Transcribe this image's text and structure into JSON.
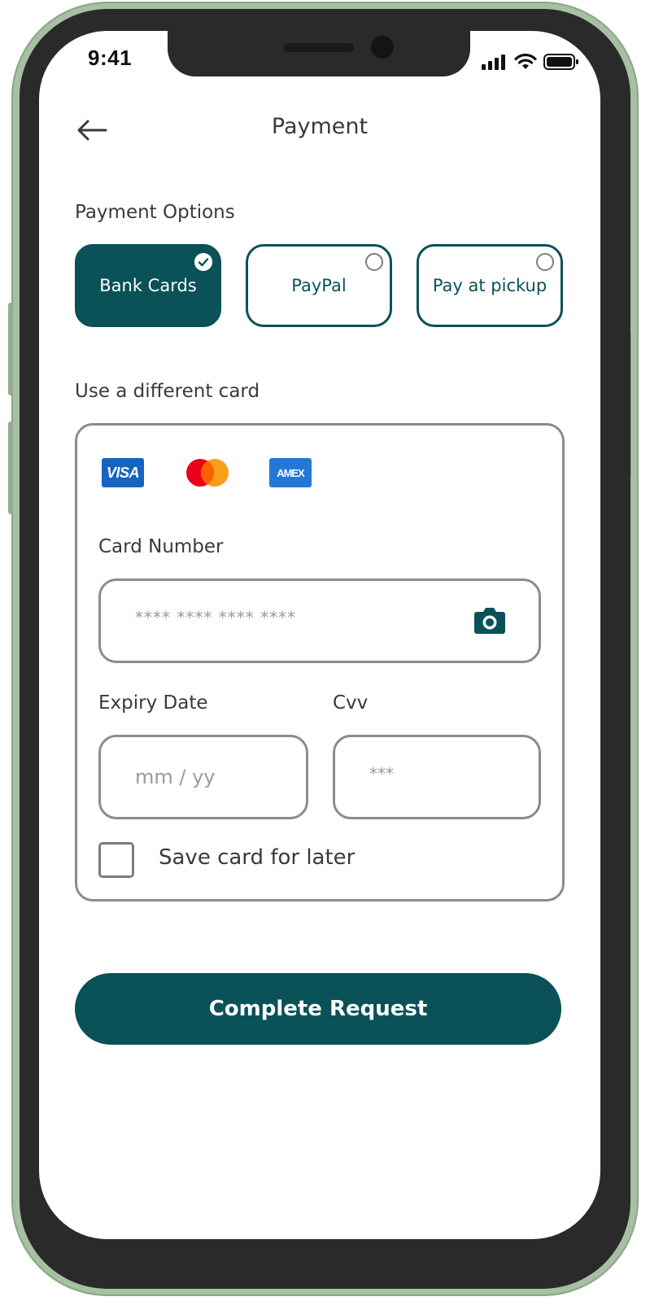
{
  "status_bar": {
    "time": "9:41",
    "icons": [
      "signal-icon",
      "wifi-icon",
      "battery-icon"
    ]
  },
  "header": {
    "back_icon": "arrow-left-icon",
    "title": "Payment"
  },
  "payment_options": {
    "label": "Payment Options",
    "options": [
      {
        "label": "Bank Cards",
        "selected": true
      },
      {
        "label": "PayPal",
        "selected": false
      },
      {
        "label": "Pay at pickup",
        "selected": false
      }
    ]
  },
  "card_section": {
    "label": "Use a different card",
    "brands": {
      "visa": "VISA",
      "mastercard": "mastercard-logo",
      "amex": "AMEX"
    },
    "card_number": {
      "label": "Card Number",
      "placeholder": "**** **** **** ****",
      "scan_icon": "camera-icon"
    },
    "expiry": {
      "label": "Expiry Date",
      "placeholder": "mm / yy"
    },
    "cvv": {
      "label": "Cvv",
      "placeholder": "***"
    },
    "save_card": {
      "label": "Save card for later",
      "checked": false
    }
  },
  "submit": {
    "label": "Complete Request"
  },
  "colors": {
    "primary": "#0a5158",
    "border": "#8c8c8c",
    "text": "#3a3a3a",
    "placeholder": "#9a9a9a",
    "frame": "#a7c0a3"
  }
}
